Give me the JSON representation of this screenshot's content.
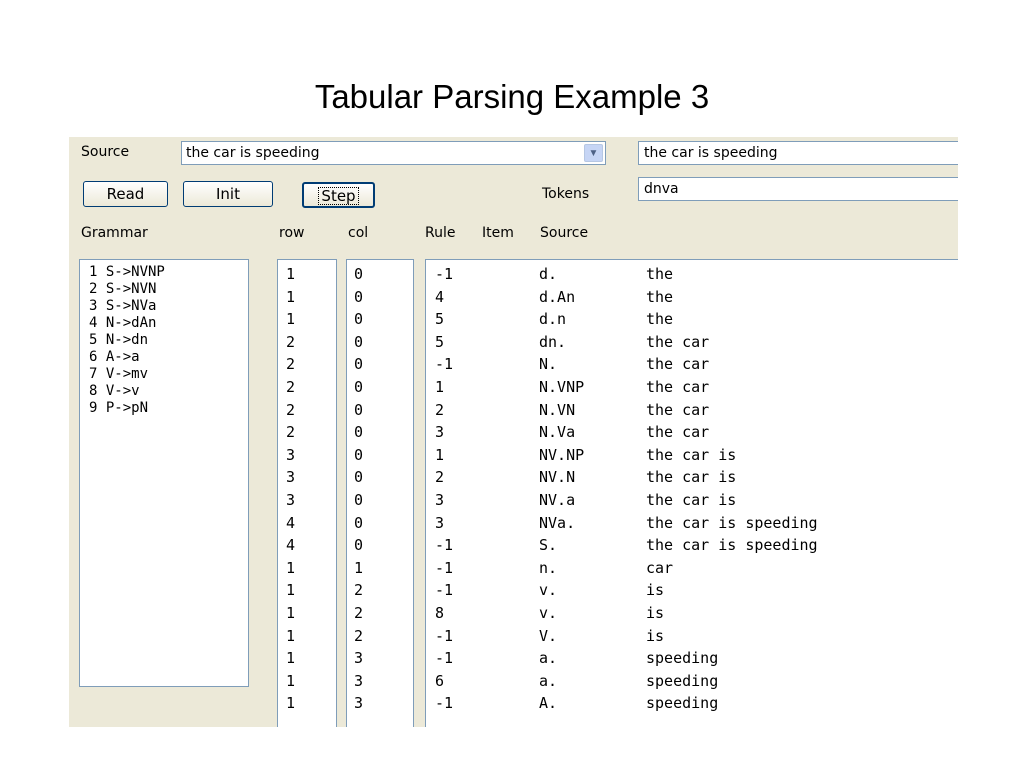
{
  "slide": {
    "title": "Tabular Parsing Example 3"
  },
  "form": {
    "source_label": "Source",
    "source_value": "the car is speeding",
    "source_right_value": "the car is speeding",
    "tokens_label": "Tokens",
    "tokens_value": "dnva",
    "buttons": {
      "read": "Read",
      "init": "Init",
      "step": "Step"
    }
  },
  "headers": {
    "grammar": "Grammar",
    "row": "row",
    "col": "col",
    "rule": "Rule",
    "item": "Item",
    "source": "Source"
  },
  "grammar": [
    "1 S->NVNP",
    "2 S->NVN",
    "3 S->NVa",
    "4 N->dAn",
    "5 N->dn",
    "6 A->a",
    "7 V->mv",
    "8 V->v",
    "9 P->pN"
  ],
  "table": {
    "rows": [
      {
        "row": "1",
        "col": "0",
        "rule": "-1",
        "item": "d.",
        "source": "the"
      },
      {
        "row": "1",
        "col": "0",
        "rule": "4",
        "item": "d.An",
        "source": "the"
      },
      {
        "row": "1",
        "col": "0",
        "rule": "5",
        "item": "d.n",
        "source": "the"
      },
      {
        "row": "2",
        "col": "0",
        "rule": "5",
        "item": "dn.",
        "source": "the car"
      },
      {
        "row": "2",
        "col": "0",
        "rule": "-1",
        "item": "N.",
        "source": "the car"
      },
      {
        "row": "2",
        "col": "0",
        "rule": "1",
        "item": "N.VNP",
        "source": "the car"
      },
      {
        "row": "2",
        "col": "0",
        "rule": "2",
        "item": "N.VN",
        "source": "the car"
      },
      {
        "row": "2",
        "col": "0",
        "rule": "3",
        "item": "N.Va",
        "source": "the car"
      },
      {
        "row": "3",
        "col": "0",
        "rule": "1",
        "item": "NV.NP",
        "source": "the car is"
      },
      {
        "row": "3",
        "col": "0",
        "rule": "2",
        "item": "NV.N",
        "source": "the car is"
      },
      {
        "row": "3",
        "col": "0",
        "rule": "3",
        "item": "NV.a",
        "source": "the car is"
      },
      {
        "row": "4",
        "col": "0",
        "rule": "3",
        "item": "NVa.",
        "source": "the car is speeding"
      },
      {
        "row": "4",
        "col": "0",
        "rule": "-1",
        "item": "S.",
        "source": "the car is speeding"
      },
      {
        "row": "1",
        "col": "1",
        "rule": "-1",
        "item": "n.",
        "source": "car"
      },
      {
        "row": "1",
        "col": "2",
        "rule": "-1",
        "item": "v.",
        "source": "is"
      },
      {
        "row": "1",
        "col": "2",
        "rule": "8",
        "item": "v.",
        "source": "is"
      },
      {
        "row": "1",
        "col": "2",
        "rule": "-1",
        "item": "V.",
        "source": "is"
      },
      {
        "row": "1",
        "col": "3",
        "rule": "-1",
        "item": "a.",
        "source": "speeding"
      },
      {
        "row": "1",
        "col": "3",
        "rule": "6",
        "item": "a.",
        "source": "speeding"
      },
      {
        "row": "1",
        "col": "3",
        "rule": "-1",
        "item": "A.",
        "source": "speeding"
      }
    ]
  },
  "icons": {
    "dropdown": "chevron-down-icon"
  },
  "colors": {
    "window_bg": "#ece9d8",
    "field_border": "#7f9db9",
    "button_border": "#003c74"
  }
}
